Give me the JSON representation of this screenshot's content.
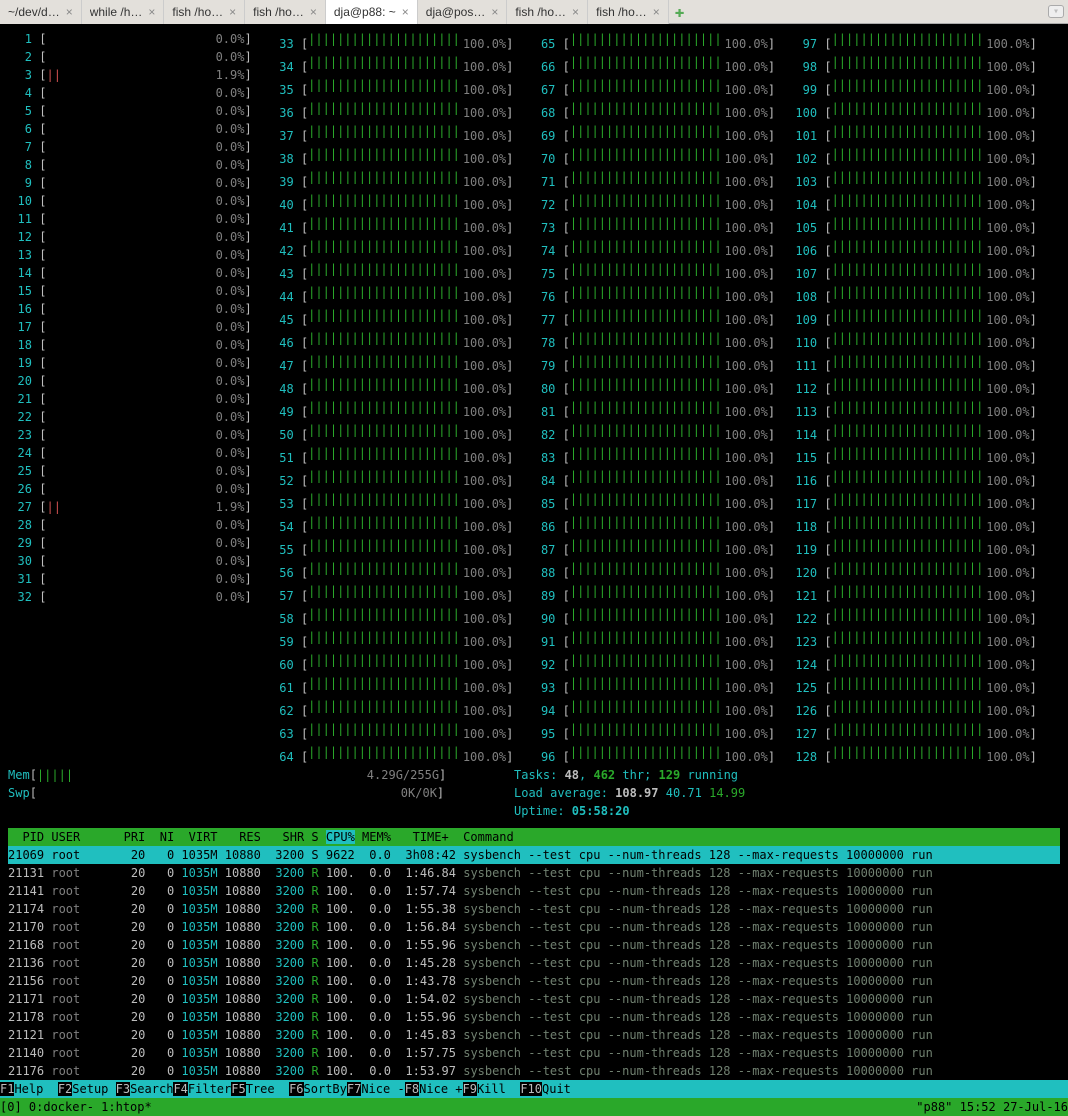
{
  "tabs": [
    {
      "label": "~/dev/d…",
      "active": false
    },
    {
      "label": "while /h…",
      "active": false
    },
    {
      "label": "fish /ho…",
      "active": false
    },
    {
      "label": "fish /ho…",
      "active": false
    },
    {
      "label": "dja@p88: ~",
      "active": true
    },
    {
      "label": "dja@pos…",
      "active": false
    },
    {
      "label": "fish /ho…",
      "active": false
    },
    {
      "label": "fish /ho…",
      "active": false
    }
  ],
  "cpus": {
    "col1": [
      {
        "n": 1,
        "p": "0.0%"
      },
      {
        "n": 2,
        "p": "0.0%"
      },
      {
        "n": 3,
        "p": "1.9%",
        "low": true
      },
      {
        "n": 4,
        "p": "0.0%"
      },
      {
        "n": 5,
        "p": "0.0%"
      },
      {
        "n": 6,
        "p": "0.0%"
      },
      {
        "n": 7,
        "p": "0.0%"
      },
      {
        "n": 8,
        "p": "0.0%"
      },
      {
        "n": 9,
        "p": "0.0%"
      },
      {
        "n": 10,
        "p": "0.0%"
      },
      {
        "n": 11,
        "p": "0.0%"
      },
      {
        "n": 12,
        "p": "0.0%"
      },
      {
        "n": 13,
        "p": "0.0%"
      },
      {
        "n": 14,
        "p": "0.0%"
      },
      {
        "n": 15,
        "p": "0.0%"
      },
      {
        "n": 16,
        "p": "0.0%"
      },
      {
        "n": 17,
        "p": "0.0%"
      },
      {
        "n": 18,
        "p": "0.0%"
      },
      {
        "n": 19,
        "p": "0.0%"
      },
      {
        "n": 20,
        "p": "0.0%"
      },
      {
        "n": 21,
        "p": "0.0%"
      },
      {
        "n": 22,
        "p": "0.0%"
      },
      {
        "n": 23,
        "p": "0.0%"
      },
      {
        "n": 24,
        "p": "0.0%"
      },
      {
        "n": 25,
        "p": "0.0%"
      },
      {
        "n": 26,
        "p": "0.0%"
      },
      {
        "n": 27,
        "p": "1.9%",
        "low": true
      },
      {
        "n": 28,
        "p": "0.0%"
      },
      {
        "n": 29,
        "p": "0.0%"
      },
      {
        "n": 30,
        "p": "0.0%"
      },
      {
        "n": 31,
        "p": "0.0%"
      },
      {
        "n": 32,
        "p": "0.0%"
      }
    ],
    "col2": [
      {
        "n": 33,
        "f": true
      },
      {
        "n": 34,
        "f": true
      },
      {
        "n": 35,
        "f": true
      },
      {
        "n": 36,
        "f": true
      },
      {
        "n": 37,
        "f": true
      },
      {
        "n": 38,
        "f": true
      },
      {
        "n": 39,
        "f": true
      },
      {
        "n": 40,
        "f": true
      },
      {
        "n": 41,
        "f": true
      },
      {
        "n": 42,
        "f": true
      },
      {
        "n": 43,
        "f": true
      },
      {
        "n": 44,
        "f": true
      },
      {
        "n": 45,
        "f": true
      },
      {
        "n": 46,
        "f": true
      },
      {
        "n": 47,
        "f": true
      },
      {
        "n": 48,
        "f": true
      },
      {
        "n": 49,
        "f": true
      },
      {
        "n": 50,
        "f": true
      },
      {
        "n": 51,
        "f": true
      },
      {
        "n": 52,
        "f": true
      },
      {
        "n": 53,
        "f": true
      },
      {
        "n": 54,
        "f": true
      },
      {
        "n": 55,
        "f": true
      },
      {
        "n": 56,
        "f": true
      },
      {
        "n": 57,
        "f": true
      },
      {
        "n": 58,
        "f": true
      },
      {
        "n": 59,
        "f": true
      },
      {
        "n": 60,
        "f": true
      },
      {
        "n": 61,
        "f": true
      },
      {
        "n": 62,
        "f": true
      },
      {
        "n": 63,
        "f": true
      },
      {
        "n": 64,
        "f": true
      }
    ],
    "col3": [
      {
        "n": 65,
        "f": true
      },
      {
        "n": 66,
        "f": true
      },
      {
        "n": 67,
        "f": true
      },
      {
        "n": 68,
        "f": true
      },
      {
        "n": 69,
        "f": true
      },
      {
        "n": 70,
        "f": true
      },
      {
        "n": 71,
        "f": true
      },
      {
        "n": 72,
        "f": true
      },
      {
        "n": 73,
        "f": true
      },
      {
        "n": 74,
        "f": true
      },
      {
        "n": 75,
        "f": true
      },
      {
        "n": 76,
        "f": true
      },
      {
        "n": 77,
        "f": true
      },
      {
        "n": 78,
        "f": true
      },
      {
        "n": 79,
        "f": true
      },
      {
        "n": 80,
        "f": true
      },
      {
        "n": 81,
        "f": true
      },
      {
        "n": 82,
        "f": true
      },
      {
        "n": 83,
        "f": true
      },
      {
        "n": 84,
        "f": true
      },
      {
        "n": 85,
        "f": true
      },
      {
        "n": 86,
        "f": true
      },
      {
        "n": 87,
        "f": true
      },
      {
        "n": 88,
        "f": true
      },
      {
        "n": 89,
        "f": true
      },
      {
        "n": 90,
        "f": true
      },
      {
        "n": 91,
        "f": true
      },
      {
        "n": 92,
        "f": true
      },
      {
        "n": 93,
        "f": true
      },
      {
        "n": 94,
        "f": true
      },
      {
        "n": 95,
        "f": true
      },
      {
        "n": 96,
        "f": true
      }
    ],
    "col4": [
      {
        "n": 97,
        "f": true
      },
      {
        "n": 98,
        "f": true
      },
      {
        "n": 99,
        "f": true
      },
      {
        "n": 100,
        "f": true
      },
      {
        "n": 101,
        "f": true
      },
      {
        "n": 102,
        "f": true
      },
      {
        "n": 103,
        "f": true
      },
      {
        "n": 104,
        "f": true
      },
      {
        "n": 105,
        "f": true
      },
      {
        "n": 106,
        "f": true
      },
      {
        "n": 107,
        "f": true
      },
      {
        "n": 108,
        "f": true
      },
      {
        "n": 109,
        "f": true
      },
      {
        "n": 110,
        "f": true
      },
      {
        "n": 111,
        "f": true
      },
      {
        "n": 112,
        "f": true
      },
      {
        "n": 113,
        "f": true
      },
      {
        "n": 114,
        "f": true
      },
      {
        "n": 115,
        "f": true
      },
      {
        "n": 116,
        "f": true
      },
      {
        "n": 117,
        "f": true
      },
      {
        "n": 118,
        "f": true
      },
      {
        "n": 119,
        "f": true
      },
      {
        "n": 120,
        "f": true
      },
      {
        "n": 121,
        "f": true
      },
      {
        "n": 122,
        "f": true
      },
      {
        "n": 123,
        "f": true
      },
      {
        "n": 124,
        "f": true
      },
      {
        "n": 125,
        "f": true
      },
      {
        "n": 126,
        "f": true
      },
      {
        "n": 127,
        "f": true
      },
      {
        "n": 128,
        "f": true
      }
    ],
    "full_pct": "100.0%"
  },
  "mem": {
    "label": "Mem",
    "bars": "|||||",
    "value": "4.29G/255G"
  },
  "swp": {
    "label": "Swp",
    "value": "0K/0K"
  },
  "tasks": {
    "label": "Tasks: ",
    "t": "48",
    "comma": ", ",
    "thr": "462",
    "thr_lbl": " thr; ",
    "run": "129",
    "run_lbl": " running"
  },
  "load": {
    "label": "Load average: ",
    "l1": "108.97",
    "l2": "40.71",
    "l3": "14.99"
  },
  "uptime": {
    "label": "Uptime: ",
    "v": "05:58:20"
  },
  "proc_header": "  PID USER      PRI  NI  VIRT   RES   SHR S CPU% MEM%   TIME+  Command",
  "procs": [
    {
      "pid": "21069",
      "user": "root",
      "pri": "20",
      "ni": "0",
      "virt": "1035M",
      "res": "10880",
      "shr": "3200",
      "s": "S",
      "cpu": "9622",
      "mem": "0.0",
      "time": "3h08:42",
      "cmd": "sysbench --test cpu --num-threads 128 --max-requests 10000000 run",
      "sel": true
    },
    {
      "pid": "21131",
      "user": "root",
      "pri": "20",
      "ni": "0",
      "virt": "1035M",
      "res": "10880",
      "shr": "3200",
      "s": "R",
      "cpu": "100.",
      "mem": "0.0",
      "time": "1:46.84",
      "cmd": "sysbench --test cpu --num-threads 128 --max-requests 10000000 run"
    },
    {
      "pid": "21141",
      "user": "root",
      "pri": "20",
      "ni": "0",
      "virt": "1035M",
      "res": "10880",
      "shr": "3200",
      "s": "R",
      "cpu": "100.",
      "mem": "0.0",
      "time": "1:57.74",
      "cmd": "sysbench --test cpu --num-threads 128 --max-requests 10000000 run"
    },
    {
      "pid": "21174",
      "user": "root",
      "pri": "20",
      "ni": "0",
      "virt": "1035M",
      "res": "10880",
      "shr": "3200",
      "s": "R",
      "cpu": "100.",
      "mem": "0.0",
      "time": "1:55.38",
      "cmd": "sysbench --test cpu --num-threads 128 --max-requests 10000000 run"
    },
    {
      "pid": "21170",
      "user": "root",
      "pri": "20",
      "ni": "0",
      "virt": "1035M",
      "res": "10880",
      "shr": "3200",
      "s": "R",
      "cpu": "100.",
      "mem": "0.0",
      "time": "1:56.84",
      "cmd": "sysbench --test cpu --num-threads 128 --max-requests 10000000 run"
    },
    {
      "pid": "21168",
      "user": "root",
      "pri": "20",
      "ni": "0",
      "virt": "1035M",
      "res": "10880",
      "shr": "3200",
      "s": "R",
      "cpu": "100.",
      "mem": "0.0",
      "time": "1:55.96",
      "cmd": "sysbench --test cpu --num-threads 128 --max-requests 10000000 run"
    },
    {
      "pid": "21136",
      "user": "root",
      "pri": "20",
      "ni": "0",
      "virt": "1035M",
      "res": "10880",
      "shr": "3200",
      "s": "R",
      "cpu": "100.",
      "mem": "0.0",
      "time": "1:45.28",
      "cmd": "sysbench --test cpu --num-threads 128 --max-requests 10000000 run"
    },
    {
      "pid": "21156",
      "user": "root",
      "pri": "20",
      "ni": "0",
      "virt": "1035M",
      "res": "10880",
      "shr": "3200",
      "s": "R",
      "cpu": "100.",
      "mem": "0.0",
      "time": "1:43.78",
      "cmd": "sysbench --test cpu --num-threads 128 --max-requests 10000000 run"
    },
    {
      "pid": "21171",
      "user": "root",
      "pri": "20",
      "ni": "0",
      "virt": "1035M",
      "res": "10880",
      "shr": "3200",
      "s": "R",
      "cpu": "100.",
      "mem": "0.0",
      "time": "1:54.02",
      "cmd": "sysbench --test cpu --num-threads 128 --max-requests 10000000 run"
    },
    {
      "pid": "21178",
      "user": "root",
      "pri": "20",
      "ni": "0",
      "virt": "1035M",
      "res": "10880",
      "shr": "3200",
      "s": "R",
      "cpu": "100.",
      "mem": "0.0",
      "time": "1:55.96",
      "cmd": "sysbench --test cpu --num-threads 128 --max-requests 10000000 run"
    },
    {
      "pid": "21121",
      "user": "root",
      "pri": "20",
      "ni": "0",
      "virt": "1035M",
      "res": "10880",
      "shr": "3200",
      "s": "R",
      "cpu": "100.",
      "mem": "0.0",
      "time": "1:45.83",
      "cmd": "sysbench --test cpu --num-threads 128 --max-requests 10000000 run"
    },
    {
      "pid": "21140",
      "user": "root",
      "pri": "20",
      "ni": "0",
      "virt": "1035M",
      "res": "10880",
      "shr": "3200",
      "s": "R",
      "cpu": "100.",
      "mem": "0.0",
      "time": "1:57.75",
      "cmd": "sysbench --test cpu --num-threads 128 --max-requests 10000000 run"
    },
    {
      "pid": "21176",
      "user": "root",
      "pri": "20",
      "ni": "0",
      "virt": "1035M",
      "res": "10880",
      "shr": "3200",
      "s": "R",
      "cpu": "100.",
      "mem": "0.0",
      "time": "1:53.97",
      "cmd": "sysbench --test cpu --num-threads 128 --max-requests 10000000 run"
    }
  ],
  "fkeys": [
    {
      "k": "F1",
      "l": "Help  "
    },
    {
      "k": "F2",
      "l": "Setup "
    },
    {
      "k": "F3",
      "l": "Search"
    },
    {
      "k": "F4",
      "l": "Filter"
    },
    {
      "k": "F5",
      "l": "Tree  "
    },
    {
      "k": "F6",
      "l": "SortBy"
    },
    {
      "k": "F7",
      "l": "Nice -"
    },
    {
      "k": "F8",
      "l": "Nice +"
    },
    {
      "k": "F9",
      "l": "Kill  "
    },
    {
      "k": "F10",
      "l": "Quit  "
    }
  ],
  "tmux": {
    "left": "[0] 0:docker- 1:htop*",
    "right": "\"p88\" 15:52 27-Jul-16"
  }
}
